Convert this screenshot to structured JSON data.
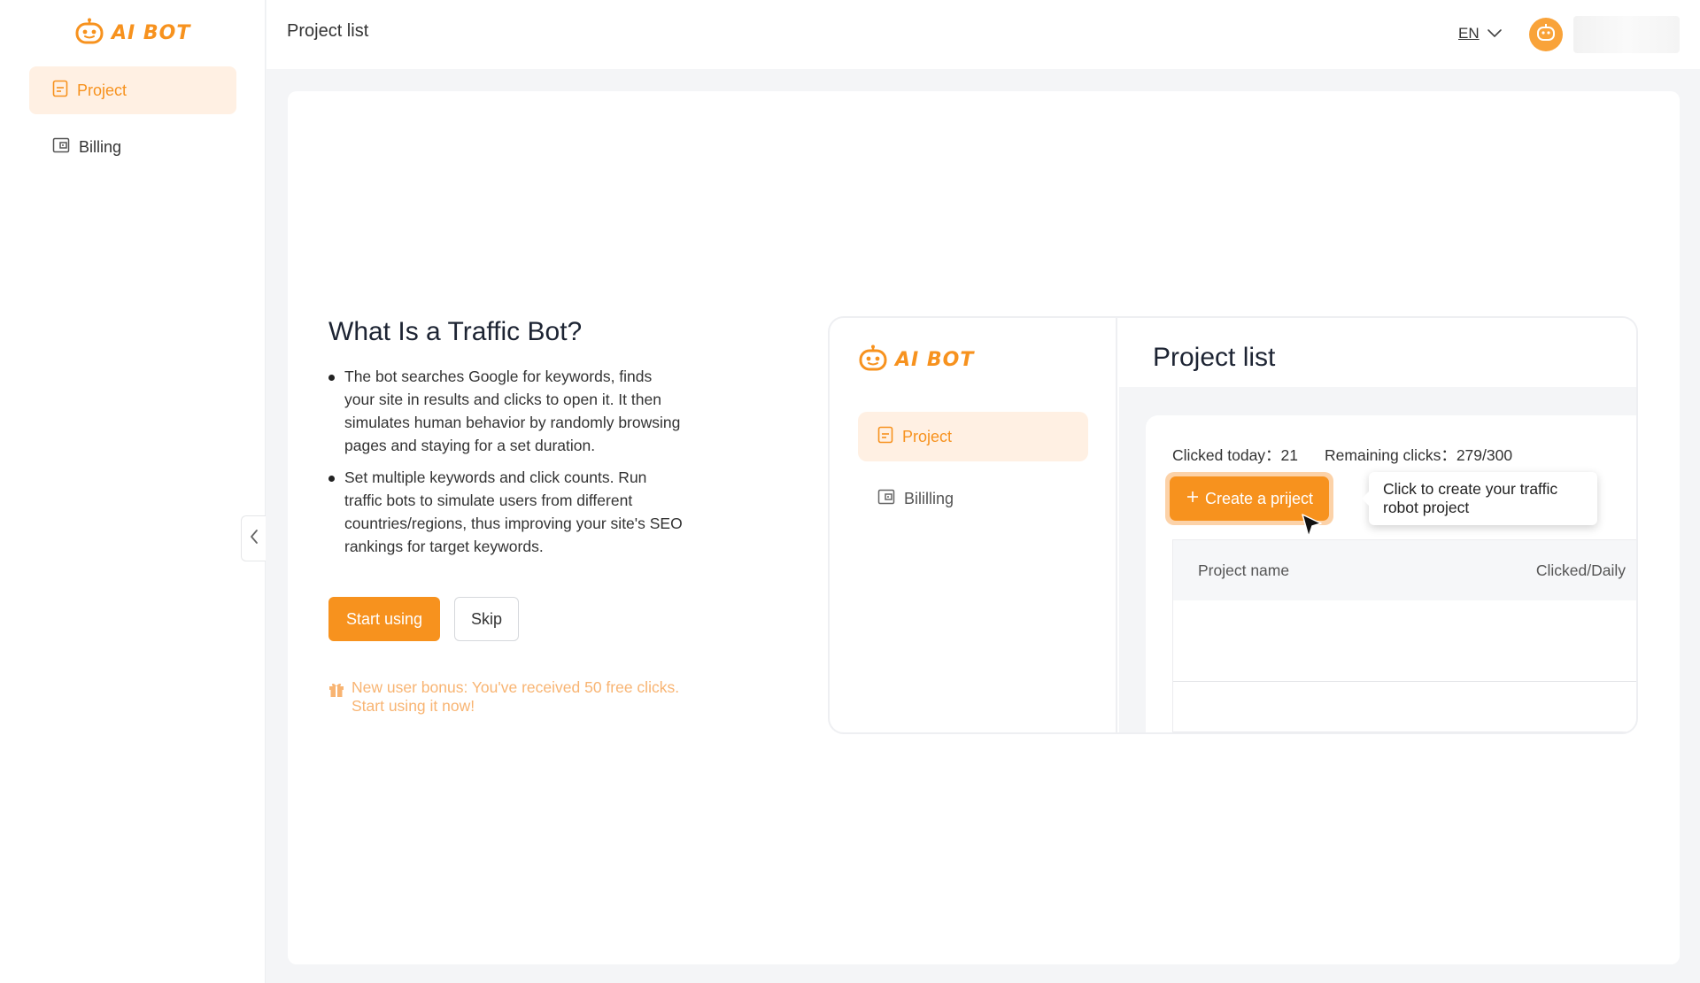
{
  "app": {
    "logo_text": "AI BOT",
    "accent_color": "#f7921e"
  },
  "sidebar": {
    "items": [
      {
        "label": "Project",
        "icon": "document-icon",
        "active": true
      },
      {
        "label": "Billing",
        "icon": "wallet-icon",
        "active": false
      }
    ]
  },
  "header": {
    "title": "Project list",
    "language": "EN"
  },
  "intro": {
    "title": "What Is a Traffic Bot?",
    "bullets": [
      "The bot searches Google for keywords, finds your site in results and clicks to open it. It then simulates human behavior by randomly browsing pages and staying for a set duration.",
      "Set multiple keywords and click counts. Run traffic bots to simulate users from different countries/regions, thus improving your site's SEO rankings for target keywords."
    ],
    "start_label": "Start using",
    "skip_label": "Skip",
    "bonus_text": "New user bonus: You've received 50 free clicks. Start using it now!"
  },
  "preview": {
    "logo_text": "AI BOT",
    "nav_items": [
      {
        "label": "Project",
        "active": true
      },
      {
        "label": "Bililling",
        "active": false
      }
    ],
    "title": "Project list",
    "clicked_today": "Clicked today：21",
    "remaining_clicks": "Remaining clicks：279/300",
    "create_label": "Create a priject",
    "tooltip": "Click to create your traffic robot project",
    "table_headers": [
      "Project name",
      "Clicked/Daily"
    ]
  }
}
